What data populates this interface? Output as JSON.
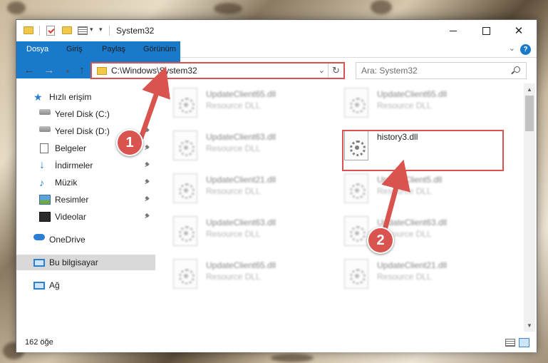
{
  "window": {
    "title": "System32",
    "controls": {
      "minimize": "",
      "maximize": "",
      "close": "✕"
    }
  },
  "ribbon": {
    "tabs": [
      "Dosya",
      "Giriş",
      "Paylaş",
      "Görünüm"
    ],
    "help": "?"
  },
  "address": {
    "path": "C:\\Windows\\System32",
    "refresh": "↻"
  },
  "search": {
    "placeholder": "Ara: System32"
  },
  "nav": {
    "items": [
      {
        "label": "Hızlı erişim",
        "icon": "star-icon",
        "pinned": false
      },
      {
        "label": "Yerel Disk (C:)",
        "icon": "drive-icon",
        "pinned": false
      },
      {
        "label": "Yerel Disk (D:)",
        "icon": "drive-icon",
        "pinned": true
      },
      {
        "label": "Belgeler",
        "icon": "documents-icon",
        "pinned": true
      },
      {
        "label": "İndirmeler",
        "icon": "downloads-icon",
        "pinned": true
      },
      {
        "label": "Müzik",
        "icon": "music-icon",
        "pinned": true
      },
      {
        "label": "Resimler",
        "icon": "pictures-icon",
        "pinned": true
      },
      {
        "label": "Videolar",
        "icon": "videos-icon",
        "pinned": true
      },
      {
        "label": "OneDrive",
        "icon": "onedrive-icon",
        "pinned": false
      },
      {
        "label": "Bu bilgisayar",
        "icon": "this-pc-icon",
        "pinned": false,
        "selected": true
      },
      {
        "label": "Ağ",
        "icon": "network-icon",
        "pinned": false
      }
    ]
  },
  "files": [
    {
      "name": "UpdateClient65.dll",
      "desc": "Resource DLL",
      "blurred": true
    },
    {
      "name": "UpdateClient65.dll",
      "desc": "Resource DLL",
      "blurred": true
    },
    {
      "name": "UpdateClient63.dll",
      "desc": "Resource DLL",
      "blurred": true
    },
    {
      "name": "history3.dll",
      "desc": "",
      "blurred": false
    },
    {
      "name": "UpdateClient21.dll",
      "desc": "Resource DLL",
      "blurred": true
    },
    {
      "name": "UpdateClient5.dll",
      "desc": "Resource DLL",
      "blurred": true
    },
    {
      "name": "UpdateClient63.dll",
      "desc": "Resource DLL",
      "blurred": true
    },
    {
      "name": "UpdateClient63.dll",
      "desc": "Resource DLL",
      "blurred": true
    },
    {
      "name": "UpdateClient65.dll",
      "desc": "Resource DLL",
      "blurred": true
    },
    {
      "name": "UpdateClient21.dll",
      "desc": "Resource DLL",
      "blurred": true
    }
  ],
  "status": {
    "count": "162 öğe"
  },
  "annotations": {
    "badge1": "1",
    "badge2": "2",
    "color": "#d9534f"
  }
}
